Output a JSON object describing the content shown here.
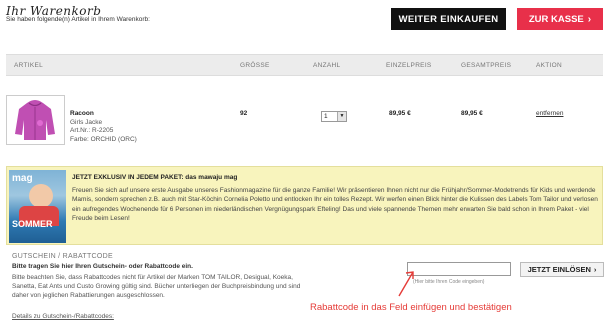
{
  "header": {
    "title": "Ihr Warenkorb",
    "subtitle": "Sie haben folgende(n) Artikel in Ihrem Warenkorb:",
    "continue_label": "WEITER EINKAUFEN",
    "checkout_label": "ZUR KASSE",
    "checkout_icon": "chevron-right-icon"
  },
  "table": {
    "headers": [
      "ARTIKEL",
      "GRÖSSE",
      "ANZAHL",
      "EINZELPREIS",
      "GESAMTPREIS",
      "AKTION"
    ]
  },
  "item": {
    "name": "Racoon",
    "type": "Girls Jacke",
    "article_number": "Art.Nr.: R-2205",
    "color": "Farbe: ORCHID (ORC)",
    "size": "92",
    "quantity": "1",
    "unit_price": "89,95 €",
    "total_price": "89,95 €",
    "remove_label": "entfernen",
    "image_color": "#c04fb3"
  },
  "promo": {
    "cover_title": "mag",
    "cover_label": "SOMMER",
    "title": "JETZT EXKLUSIV IN JEDEM PAKET: das mawaju mag",
    "text": "Freuen Sie sich auf unsere erste Ausgabe unseres Fashionmagazine für die ganze Familie! Wir präsentieren Ihnen nicht nur die Frühjahr/Sommer-Modetrends für Kids und werdende Mamis, sondern sprechen z.B. auch mit Star-Köchin Cornelia Poletto und entlocken Ihr ein tolles Rezept. Wir werfen einen Blick hinter die Kulissen des Labels Tom Tailor und verlosen ein aufregendes Wochenende für 6 Personen im niederländischen Vergnügungspark Efteling! Das und viele spannende Themen mehr erwarten Sie bald schon in Ihrem Paket - viel Freude beim Lesen!",
    "background": "#f8f4bd"
  },
  "voucher": {
    "title": "GUTSCHEIN / RABATTCODE",
    "subtitle": "Bitte tragen Sie hier Ihren Gutschein- oder Rabattcode ein.",
    "note": "Bitte beachten Sie, dass Rabattcodes nicht für Artikel der Marken TOM TAILOR, Desigual, Koeka, Sanetta, Eat Ants und Custo Growing gültig sind. Bücher unterliegen der Buchpreisbindung und sind daher von jeglichen Rabattierungen ausgeschlossen.",
    "details_link": "Details zu Gutschein-/Rabattcodes:",
    "input_value": "",
    "hint": "(Hier bitte Ihren Code eingeben)",
    "redeem_label": "JETZT EINLÖSEN",
    "redeem_icon": "chevron-right-icon"
  },
  "annotation": {
    "text": "Rabattcode in das Feld einfügen und bestätigen",
    "color": "#e53b37"
  },
  "colors": {
    "checkout": "#e8304a",
    "continue": "#111111"
  }
}
